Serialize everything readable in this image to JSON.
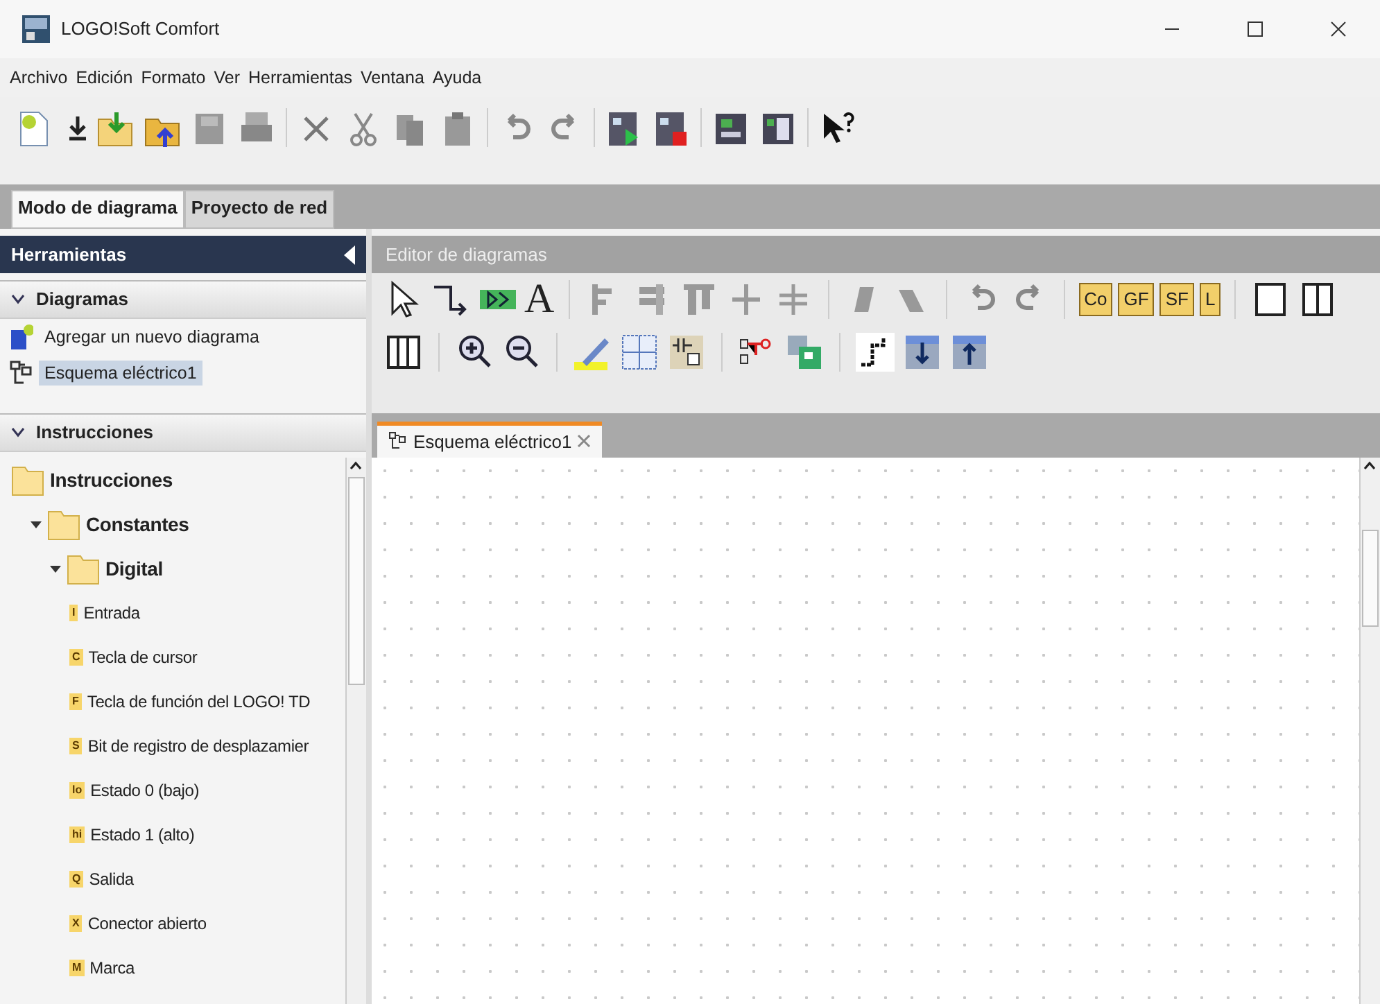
{
  "window": {
    "title": "LOGO!Soft Comfort"
  },
  "menu": [
    "Archivo",
    "Edición",
    "Formato",
    "Ver",
    "Herramientas",
    "Ventana",
    "Ayuda"
  ],
  "mode_tabs": [
    {
      "label": "Modo de diagrama",
      "selected": true
    },
    {
      "label": "Proyecto de red",
      "selected": false
    }
  ],
  "tools_panel": {
    "title": "Herramientas",
    "sections": [
      {
        "title": "Diagramas",
        "expanded": true,
        "items": [
          {
            "label": "Agregar un nuevo diagrama",
            "kind": "add",
            "selected": false
          },
          {
            "label": "Esquema eléctrico1",
            "kind": "diagram",
            "selected": true
          }
        ]
      },
      {
        "title": "Instrucciones",
        "expanded": true,
        "tree": [
          {
            "label": "Instrucciones",
            "kind": "folder",
            "children": [
              {
                "label": "Constantes",
                "kind": "folder",
                "expanded": true,
                "children": [
                  {
                    "label": "Digital",
                    "kind": "folder",
                    "expanded": true,
                    "children": [
                      {
                        "label": "Entrada",
                        "kind": "leaf",
                        "badge": "I"
                      },
                      {
                        "label": "Tecla de cursor",
                        "kind": "leaf",
                        "badge": "C"
                      },
                      {
                        "label": "Tecla de función del LOGO! TD",
                        "kind": "leaf",
                        "badge": "F"
                      },
                      {
                        "label": "Bit de registro de desplazamier",
                        "kind": "leaf",
                        "badge": "S"
                      },
                      {
                        "label": "Estado 0 (bajo)",
                        "kind": "leaf",
                        "badge": "lo"
                      },
                      {
                        "label": "Estado 1 (alto)",
                        "kind": "leaf",
                        "badge": "hi"
                      },
                      {
                        "label": "Salida",
                        "kind": "leaf",
                        "badge": "Q"
                      },
                      {
                        "label": "Conector abierto",
                        "kind": "leaf",
                        "badge": "X"
                      },
                      {
                        "label": "Marca",
                        "kind": "leaf",
                        "badge": "M"
                      }
                    ]
                  }
                ]
              }
            ]
          }
        ]
      }
    ]
  },
  "editor": {
    "title": "Editor de diagramas",
    "text_tool": "A",
    "block_buttons": [
      "Co",
      "GF",
      "SF",
      "L"
    ],
    "tabs": [
      {
        "label": "Esquema eléctrico1",
        "selected": true
      }
    ]
  }
}
